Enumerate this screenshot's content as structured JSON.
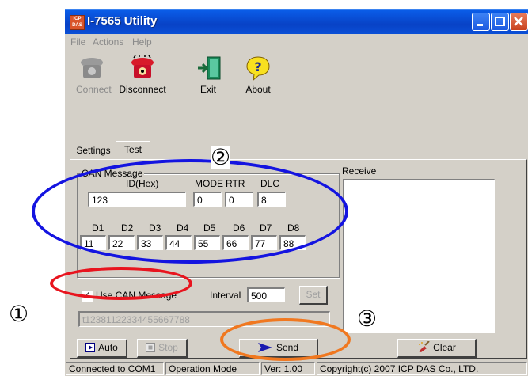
{
  "window": {
    "title": "I-7565 Utility",
    "app_icon_text": "ICP DAS"
  },
  "menu": {
    "items": [
      "File",
      "Actions",
      "Help"
    ]
  },
  "toolbar": {
    "connect_label": "Connect",
    "disconnect_label": "Disconnect",
    "exit_label": "Exit",
    "about_label": "About"
  },
  "tabs": {
    "settings_label": "Settings",
    "test_label": "Test"
  },
  "can_message": {
    "group_label": "CAN Message",
    "id_header": "ID(Hex)",
    "mode_header": "MODE",
    "rtr_header": "RTR",
    "dlc_header": "DLC",
    "id_value": "123",
    "mode_value": "0",
    "rtr_value": "0",
    "dlc_value": "8",
    "data_headers": [
      "D1",
      "D2",
      "D3",
      "D4",
      "D5",
      "D6",
      "D7",
      "D8"
    ],
    "data_values": [
      "11",
      "22",
      "33",
      "44",
      "55",
      "66",
      "77",
      "88"
    ]
  },
  "controls": {
    "use_can_message_label": "Use CAN Message",
    "use_can_message_checked": true,
    "interval_label": "Interval",
    "interval_value": "500",
    "set_label": "Set",
    "command_value": "t12381122334455667788",
    "auto_label": "Auto",
    "stop_label": "Stop",
    "send_label": "Send",
    "clear_label": "Clear"
  },
  "receive": {
    "label": "Receive"
  },
  "statusbar": {
    "connection": "Connected to COM1",
    "mode": "Operation Mode",
    "version": "Ver: 1.00",
    "copyright": "Copyright(c) 2007 ICP DAS Co., LTD."
  },
  "annotations": {
    "marker_1": "①",
    "marker_2": "②",
    "marker_3": "③",
    "colors": {
      "red": "#e8141e",
      "blue": "#1414e0",
      "orange": "#f07820"
    }
  }
}
